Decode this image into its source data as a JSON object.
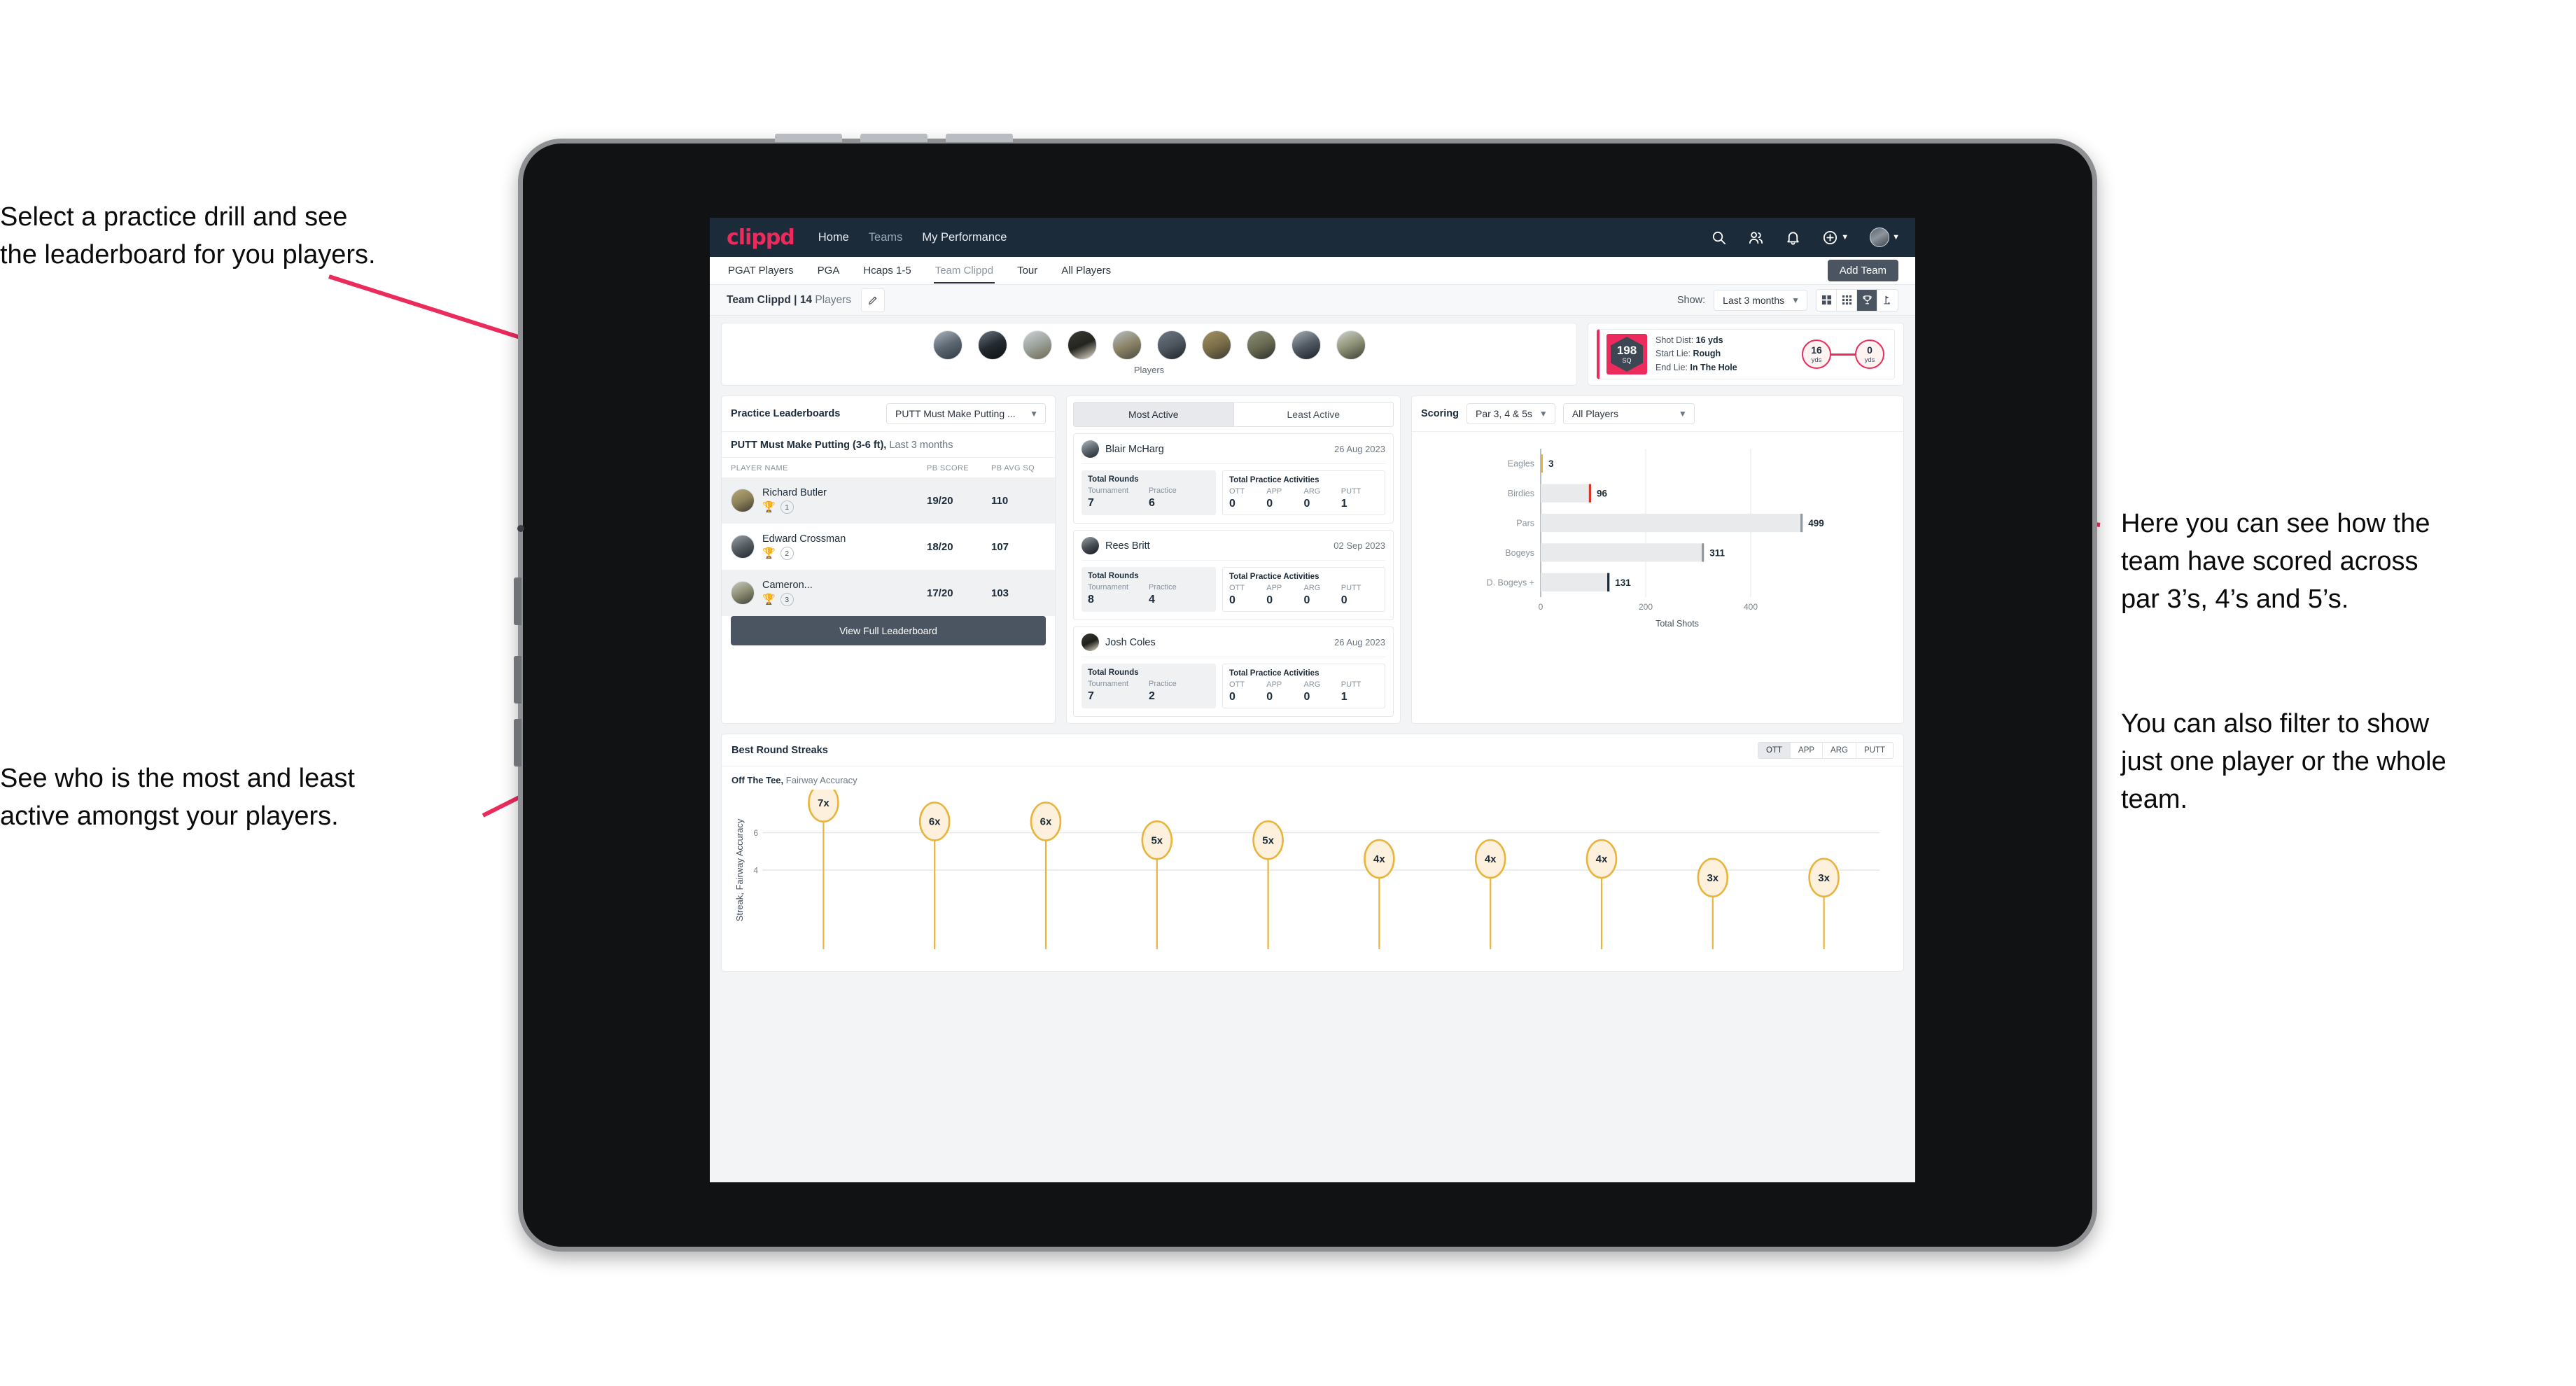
{
  "annotations": [
    {
      "id": "a",
      "text": "Select a practice drill and see\nthe leaderboard for you players."
    },
    {
      "id": "b",
      "text": "See who is the most and least\nactive amongst your players."
    },
    {
      "id": "c",
      "text": "Here you can see how the\nteam have scored across\npar 3’s, 4’s and 5’s."
    },
    {
      "id": "d",
      "text": "You can also filter to show\njust one player or the whole\nteam."
    }
  ],
  "colors": {
    "brand_pink": "#ec2b5d",
    "header_navy": "#1c2b3a",
    "button_slate": "#4a5561",
    "gold": "#e8b43c",
    "bar_grey": "#e8eaec"
  },
  "app": {
    "brand": "clippd",
    "nav": [
      {
        "label": "Home",
        "active": true
      },
      {
        "label": "Teams",
        "active": false
      },
      {
        "label": "My Performance",
        "active": true
      }
    ],
    "icons": {
      "search": "search-icon",
      "people": "people-icon",
      "bell": "bell-icon",
      "plus": "plus-circle-icon",
      "avatar": "avatar-icon"
    },
    "tabs": [
      {
        "label": "PGAT Players",
        "state": "normal"
      },
      {
        "label": "PGA",
        "state": "normal"
      },
      {
        "label": "Hcaps 1-5",
        "state": "normal"
      },
      {
        "label": "Team Clippd",
        "state": "active"
      },
      {
        "label": "Tour",
        "state": "normal"
      },
      {
        "label": "All Players",
        "state": "normal"
      }
    ],
    "add_team_label": "Add Team"
  },
  "toolbar": {
    "team_name": "Team Clippd",
    "separator": " | ",
    "player_count": "14",
    "players_word": "Players",
    "edit_icon": "pencil-icon",
    "show_label": "Show:",
    "show_value": "Last 3 months",
    "view_buttons": [
      {
        "name": "grid-large-icon",
        "selected": false
      },
      {
        "name": "grid-small-icon",
        "selected": false
      },
      {
        "name": "trophy-icon",
        "selected": true
      },
      {
        "name": "flag-icon",
        "selected": false
      }
    ]
  },
  "players_strip": {
    "caption": "Players",
    "count": 10
  },
  "shot_card": {
    "sq_value": "198",
    "sq_unit": "SQ",
    "rows": [
      {
        "label": "Shot Dist:",
        "value": "16 yds"
      },
      {
        "label": "Start Lie:",
        "value": "Rough"
      },
      {
        "label": "End Lie:",
        "value": "In The Hole"
      }
    ],
    "start_dist": {
      "value": "16",
      "unit": "yds"
    },
    "end_dist": {
      "value": "0",
      "unit": "yds"
    }
  },
  "leaderboard": {
    "title": "Practice Leaderboards",
    "drill_select": "PUTT Must Make Putting ...",
    "subtitle_bold": "PUTT Must Make Putting (3-6 ft),",
    "subtitle_light": " Last 3 months",
    "columns": [
      "PLAYER NAME",
      "PB SCORE",
      "PB AVG SQ"
    ],
    "rows": [
      {
        "name": "Richard Butler",
        "rank": "1",
        "trophy": "gold",
        "pb_score": "19/20",
        "pb_avg_sq": "110",
        "shaded": true
      },
      {
        "name": "Edward Crossman",
        "rank": "2",
        "trophy": "silver",
        "pb_score": "18/20",
        "pb_avg_sq": "107",
        "shaded": false
      },
      {
        "name": "Cameron...",
        "rank": "3",
        "trophy": "bronze",
        "pb_score": "17/20",
        "pb_avg_sq": "103",
        "shaded": true
      }
    ],
    "view_full_label": "View Full Leaderboard"
  },
  "activity": {
    "tabs": [
      {
        "label": "Most Active",
        "selected": true
      },
      {
        "label": "Least Active",
        "selected": false
      }
    ],
    "rounds_title": "Total Rounds",
    "practice_title": "Total Practice Activities",
    "rounds_keys": [
      "Tournament",
      "Practice"
    ],
    "practice_keys": [
      "OTT",
      "APP",
      "ARG",
      "PUTT"
    ],
    "cards": [
      {
        "name": "Blair McHarg",
        "date": "26 Aug 2023",
        "rounds": [
          "7",
          "6"
        ],
        "practice": [
          "0",
          "0",
          "0",
          "1"
        ]
      },
      {
        "name": "Rees Britt",
        "date": "02 Sep 2023",
        "rounds": [
          "8",
          "4"
        ],
        "practice": [
          "0",
          "0",
          "0",
          "0"
        ]
      },
      {
        "name": "Josh Coles",
        "date": "26 Aug 2023",
        "rounds": [
          "7",
          "2"
        ],
        "practice": [
          "0",
          "0",
          "0",
          "1"
        ]
      }
    ]
  },
  "scoring": {
    "title": "Scoring",
    "par_select": "Par 3, 4 & 5s",
    "player_select": "All Players"
  },
  "streaks": {
    "title": "Best Round Streaks",
    "segments": [
      {
        "label": "OTT",
        "selected": true
      },
      {
        "label": "APP",
        "selected": false
      },
      {
        "label": "ARG",
        "selected": false
      },
      {
        "label": "PUTT",
        "selected": false
      }
    ],
    "subtitle_bold": "Off The Tee,",
    "subtitle_light": " Fairway Accuracy"
  },
  "chart_data": [
    {
      "type": "bar",
      "orientation": "horizontal",
      "title": "Scoring",
      "categories": [
        "Eagles",
        "Birdies",
        "Pars",
        "Bogeys",
        "D. Bogeys +"
      ],
      "values": [
        3,
        96,
        499,
        311,
        131
      ],
      "bar_colors": [
        "#e8b43c",
        "#e0352b",
        "#8f979f",
        "#8f979f",
        "#1c2b3a"
      ],
      "xlabel": "Total Shots",
      "ylabel": "",
      "xticks": [
        0,
        200,
        400
      ],
      "xlim": [
        0,
        520
      ],
      "grid": true,
      "legend": "none"
    },
    {
      "type": "bar",
      "orientation": "vertical",
      "title": "Best Round Streaks",
      "subtitle": "Off The Tee, Fairway Accuracy",
      "categories": [
        "p1",
        "p2",
        "p3",
        "p4",
        "p5",
        "p6",
        "p7",
        "p8",
        "p9",
        "p10"
      ],
      "values": [
        7,
        6,
        6,
        5,
        5,
        4,
        4,
        4,
        3,
        3
      ],
      "data_labels": [
        "7x",
        "6x",
        "6x",
        "5x",
        "5x",
        "4x",
        "4x",
        "4x",
        "3x",
        "3x"
      ],
      "ylabel": "Streak, Fairway Accuracy",
      "yticks": [
        4,
        6
      ],
      "ylim": [
        0,
        8
      ],
      "marker_color": "#e8b43c",
      "marker_fill": "#fdf1dd",
      "grid": true,
      "legend": "none"
    }
  ]
}
